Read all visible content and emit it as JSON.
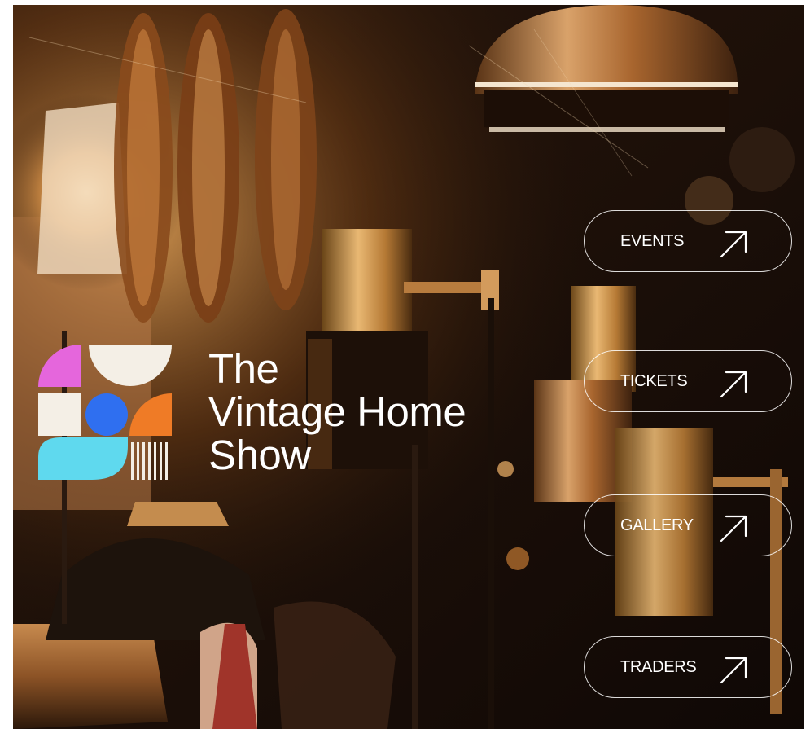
{
  "brand": {
    "title_lines": [
      "The",
      "Vintage Home",
      "Show"
    ],
    "logo_icon": "vintage-home-show-logo-icon",
    "colors": {
      "pink": "#e566dc",
      "cream": "#f4efe6",
      "blue": "#2f6ff0",
      "orange": "#ef7b26",
      "cyan": "#5fd9ee",
      "text": "#ffffff"
    }
  },
  "background": {
    "icon": "vintage-lamps-photo",
    "palette": [
      "#1a0f08",
      "#b8763a",
      "#f0b060",
      "#2a1a10"
    ]
  },
  "nav": [
    {
      "label": "EVENTS",
      "icon": "arrow-up-right-icon"
    },
    {
      "label": "TICKETS",
      "icon": "arrow-up-right-icon"
    },
    {
      "label": "GALLERY",
      "icon": "arrow-up-right-icon"
    },
    {
      "label": "TRADERS",
      "icon": "arrow-up-right-icon"
    }
  ]
}
